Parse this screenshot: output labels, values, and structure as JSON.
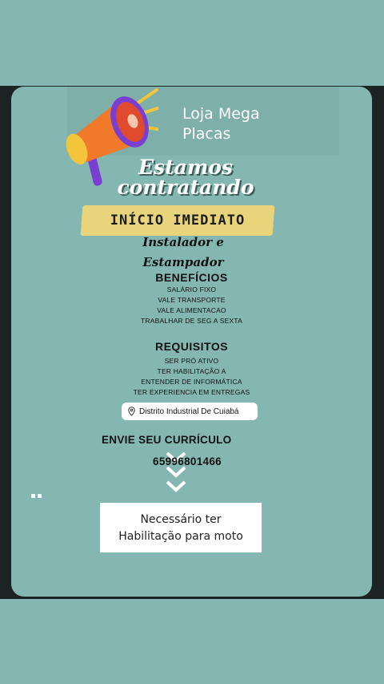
{
  "brand": {
    "line1": "Loja Mega",
    "line2": "Placas"
  },
  "headline": {
    "line1": "Estamos",
    "line2": "contratando"
  },
  "banner": "INÍCIO IMEDIATO",
  "role": {
    "line1": "Instalador e",
    "line2": "Estampador"
  },
  "benefits": {
    "title": "BENEFÍCIOS",
    "items": [
      "SALÁRIO FIXO",
      "VALE TRANSPORTE",
      "VALE ALIMENTACAO",
      "TRABALHAR DE SEG A SEXTA"
    ]
  },
  "requirements": {
    "title": "REQUISITOS",
    "items": [
      "SER PRÓ ATIVO",
      "TER HABILITAÇÃO A",
      "ENTENDER DE INFORMÁTICA",
      "TER EXPERIENCIA EM ENTREGAS"
    ]
  },
  "location": {
    "icon": "location-pin-icon",
    "label": "Distrito Industrial De Cuiabá"
  },
  "cta": {
    "label": "ENVIE SEU CURRÍCULO",
    "phone": "65996801466"
  },
  "note": {
    "line1": "Necessário ter",
    "line2": "Habilitação para moto"
  },
  "colors": {
    "card_bg": "#84b7b1",
    "highlight": "#e8d47a",
    "story_bg": "#1d2322",
    "megaphone_orange": "#f07a2a",
    "megaphone_purple": "#7a3fd0"
  }
}
